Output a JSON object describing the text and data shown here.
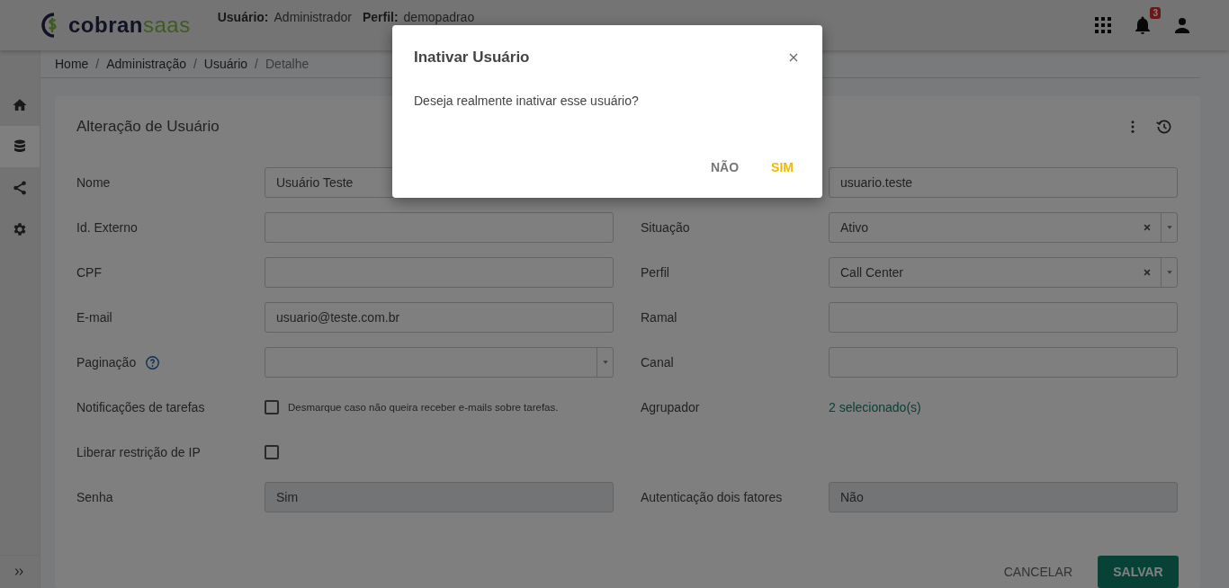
{
  "header": {
    "logo": [
      "cobran",
      "saas"
    ],
    "user_label": "Usuário:",
    "user": "Administrador",
    "profile_label": "Perfil:",
    "profile": "demopadrao",
    "notification_count": "3"
  },
  "sidebar": {
    "items": [
      {
        "selected": false
      },
      {
        "selected": true
      },
      {
        "selected": false
      },
      {
        "selected": false
      }
    ]
  },
  "breadcrumb": [
    {
      "label": "Home",
      "current": false
    },
    {
      "separator": "/",
      "label": "Administração",
      "current": false
    },
    {
      "separator": "/",
      "label": "Usuário",
      "current": false
    },
    {
      "separator": "/",
      "label": "Detalhe",
      "current": true
    }
  ],
  "card": {
    "title": "Alteração de Usuário",
    "rows": [
      {
        "left": {
          "label": "Nome",
          "kind": "input",
          "value": "Usuário Teste"
        },
        "right": {
          "kind": "input",
          "value": "usuario.teste"
        }
      },
      {
        "left": {
          "label": "Id. Externo",
          "kind": "input"
        },
        "right": {
          "label": "Situação",
          "kind": "select",
          "value": "Ativo",
          "clearable": true
        }
      },
      {
        "left": {
          "label": "CPF",
          "kind": "input"
        },
        "right": {
          "label": "Perfil",
          "kind": "select",
          "value": "Call Center",
          "clearable": true
        }
      },
      {
        "left": {
          "label": "E-mail",
          "kind": "input",
          "value": "usuario@teste.com.br"
        },
        "right": {
          "label": "Ramal",
          "kind": "input"
        }
      },
      {
        "left": {
          "label": "Paginação",
          "help": true,
          "kind": "select",
          "clearable": false
        },
        "right": {
          "label": "Canal",
          "kind": "input"
        }
      },
      {
        "left": {
          "label": "Notificações de tarefas",
          "kind": "checkbox",
          "checked": false,
          "hint": "Desmarque caso não queira receber e-mails sobre tarefas."
        },
        "right": {
          "label": "Agrupador",
          "kind": "link",
          "value": "2 selecionado(s)"
        }
      },
      {
        "left": {
          "label": "Liberar restrição de IP",
          "kind": "checkbox",
          "checked": false
        }
      },
      {
        "left": {
          "label": "Senha",
          "kind": "readonly",
          "value": "Sim"
        },
        "right": {
          "label": "Autenticação dois fatores",
          "kind": "readonly",
          "value": "Não"
        }
      }
    ],
    "buttons": [
      {
        "label": "CANCELAR",
        "kind": "text"
      },
      {
        "label": "SALVAR",
        "kind": "primary"
      }
    ]
  },
  "dialog": {
    "title": "Inativar Usuário",
    "message": "Deseja realmente inativar esse usuário?",
    "buttons": [
      {
        "label": "NÃO",
        "kind": "secondary"
      },
      {
        "label": "SIM",
        "kind": "primary"
      }
    ]
  }
}
